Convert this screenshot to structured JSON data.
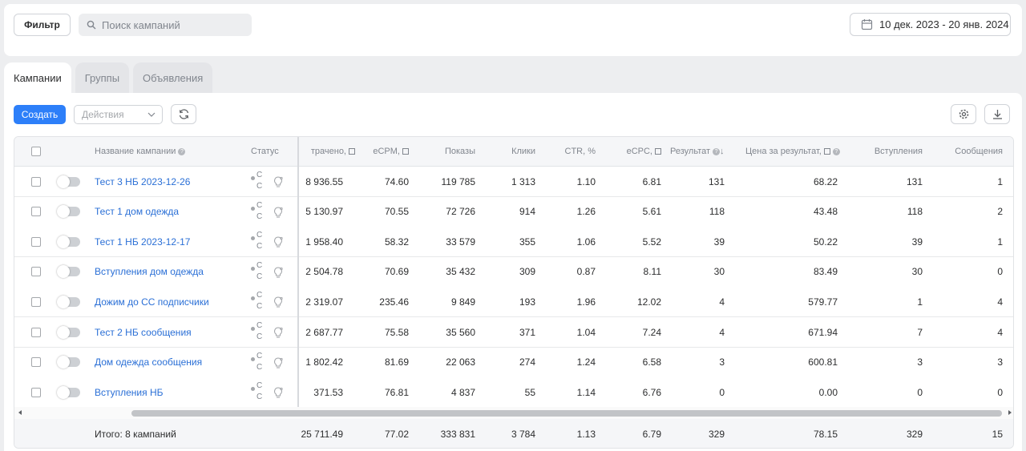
{
  "topbar": {
    "filter_label": "Фильтр",
    "search_placeholder": "Поиск кампаний",
    "date_range": "10 дек. 2023 - 20 янв. 2024"
  },
  "tabs": [
    {
      "label": "Кампании",
      "active": true
    },
    {
      "label": "Группы",
      "active": false
    },
    {
      "label": "Объявления",
      "active": false
    }
  ],
  "toolbar": {
    "create_label": "Создать",
    "actions_placeholder": "Действия"
  },
  "table": {
    "headers": {
      "name": "Название кампании",
      "status": "Статус",
      "spent": "трачено,",
      "ecpm": "eCPM,",
      "shows": "Показы",
      "clicks": "Клики",
      "ctr": "CTR, %",
      "ecpc": "eCPC,",
      "result": "Результат",
      "result_sort": "↓",
      "cost_per_result": "Цена за результат,",
      "joins": "Вступления",
      "messages": "Сообщения"
    },
    "status_fragment": "С",
    "rows": [
      {
        "name": "Тест 3 НБ 2023-12-26",
        "spent": "8 936.55",
        "ecpm": "74.60",
        "shows": "119 785",
        "clicks": "1 313",
        "ctr": "1.10",
        "ecpc": "6.81",
        "result": "131",
        "cost": "68.22",
        "joins": "131",
        "messages": "1"
      },
      {
        "name": "Тест 1 дом одежда",
        "spent": "5 130.97",
        "ecpm": "70.55",
        "shows": "72 726",
        "clicks": "914",
        "ctr": "1.26",
        "ecpc": "5.61",
        "result": "118",
        "cost": "43.48",
        "joins": "118",
        "messages": "2"
      },
      {
        "name": "Тест 1 НБ 2023-12-17",
        "spent": "1 958.40",
        "ecpm": "58.32",
        "shows": "33 579",
        "clicks": "355",
        "ctr": "1.06",
        "ecpc": "5.52",
        "result": "39",
        "cost": "50.22",
        "joins": "39",
        "messages": "1"
      },
      {
        "name": "Вступления дом одежда",
        "spent": "2 504.78",
        "ecpm": "70.69",
        "shows": "35 432",
        "clicks": "309",
        "ctr": "0.87",
        "ecpc": "8.11",
        "result": "30",
        "cost": "83.49",
        "joins": "30",
        "messages": "0"
      },
      {
        "name": "Дожим до СС подписчики",
        "spent": "2 319.07",
        "ecpm": "235.46",
        "shows": "9 849",
        "clicks": "193",
        "ctr": "1.96",
        "ecpc": "12.02",
        "result": "4",
        "cost": "579.77",
        "joins": "1",
        "messages": "4"
      },
      {
        "name": "Тест 2 НБ сообщения",
        "spent": "2 687.77",
        "ecpm": "75.58",
        "shows": "35 560",
        "clicks": "371",
        "ctr": "1.04",
        "ecpc": "7.24",
        "result": "4",
        "cost": "671.94",
        "joins": "7",
        "messages": "4"
      },
      {
        "name": "Дом одежда сообщения",
        "spent": "1 802.42",
        "ecpm": "81.69",
        "shows": "22 063",
        "clicks": "274",
        "ctr": "1.24",
        "ecpc": "6.58",
        "result": "3",
        "cost": "600.81",
        "joins": "3",
        "messages": "3"
      },
      {
        "name": "Вступления НБ",
        "spent": "371.53",
        "ecpm": "76.81",
        "shows": "4 837",
        "clicks": "55",
        "ctr": "1.14",
        "ecpc": "6.76",
        "result": "0",
        "cost": "0.00",
        "joins": "0",
        "messages": "0"
      }
    ],
    "total": {
      "label": "Итого: 8 кампаний",
      "spent": "25 711.49",
      "ecpm": "77.02",
      "shows": "333 831",
      "clicks": "3 784",
      "ctr": "1.13",
      "ecpc": "6.79",
      "result": "329",
      "cost": "78.15",
      "joins": "329",
      "messages": "15"
    }
  },
  "colors": {
    "accent": "#2d7ff9",
    "link": "#2a6fd6"
  }
}
